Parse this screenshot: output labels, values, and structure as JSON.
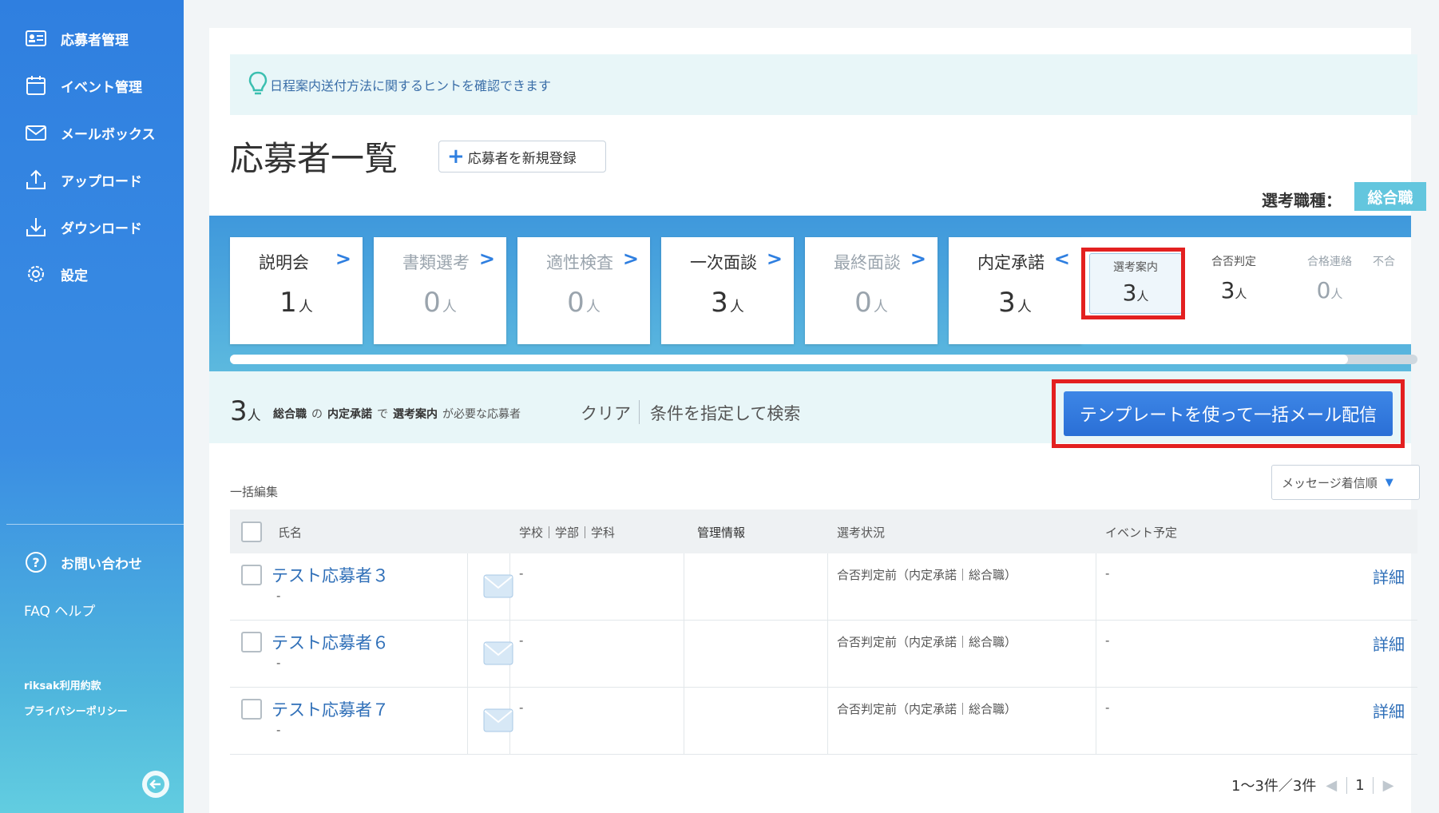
{
  "sidebar": {
    "items": [
      {
        "label": "応募者管理",
        "icon": "id-card-icon"
      },
      {
        "label": "イベント管理",
        "icon": "calendar-icon"
      },
      {
        "label": "メールボックス",
        "icon": "mail-icon"
      },
      {
        "label": "アップロード",
        "icon": "upload-icon"
      },
      {
        "label": "ダウンロード",
        "icon": "download-icon"
      },
      {
        "label": "設定",
        "icon": "gear-icon"
      }
    ],
    "contact": "お問い合わせ",
    "faq": "FAQ ヘルプ",
    "terms": "riksak利用約款",
    "privacy": "プライバシーポリシー"
  },
  "hint": {
    "text": "日程案内送付方法に関するヒントを確認できます"
  },
  "page_title": "応募者一覧",
  "register_button": "応募者を新規登録",
  "job": {
    "label": "選考職種：",
    "value": "総合職"
  },
  "stages": [
    {
      "name": "説明会",
      "count": "1",
      "unit": "人",
      "dim": false
    },
    {
      "name": "書類選考",
      "count": "0",
      "unit": "人",
      "dim": true
    },
    {
      "name": "適性検査",
      "count": "0",
      "unit": "人",
      "dim": true
    },
    {
      "name": "一次面談",
      "count": "3",
      "unit": "人",
      "dim": false
    },
    {
      "name": "最終面談",
      "count": "0",
      "unit": "人",
      "dim": true
    },
    {
      "name": "内定承諾",
      "count": "3",
      "unit": "人",
      "dim": false
    }
  ],
  "substages": [
    {
      "name": "選考案内",
      "count": "3",
      "unit": "人",
      "dim": false
    },
    {
      "name": "合否判定",
      "count": "3",
      "unit": "人",
      "dim": false
    },
    {
      "name": "合格連絡",
      "count": "0",
      "unit": "人",
      "dim": true
    },
    {
      "name": "不合",
      "count": "",
      "unit": "",
      "dim": true
    }
  ],
  "filter": {
    "count": "3",
    "unit": "人",
    "job": "総合職",
    "no": "の",
    "stage": "内定承諾",
    "de": "で",
    "substage": "選考案内",
    "suffix": "が必要な応募者",
    "clear": "クリア",
    "search": "条件を指定して検索",
    "template_button": "テンプレートを使って一括メール配信"
  },
  "bulk_edit": "一括編集",
  "sort": {
    "selected": "メッセージ着信順"
  },
  "table": {
    "headers": {
      "name": "氏名",
      "school": "学校｜学部｜学科",
      "mgmt": "管理情報",
      "status": "選考状況",
      "event": "イベント予定"
    },
    "rows": [
      {
        "name": "テスト応募者３",
        "sub": "-",
        "school": "-",
        "status": "合否判定前（内定承諾｜総合職）",
        "event": "-",
        "detail": "詳細"
      },
      {
        "name": "テスト応募者６",
        "sub": "-",
        "school": "-",
        "status": "合否判定前（内定承諾｜総合職）",
        "event": "-",
        "detail": "詳細"
      },
      {
        "name": "テスト応募者７",
        "sub": "-",
        "school": "-",
        "status": "合否判定前（内定承諾｜総合職）",
        "event": "-",
        "detail": "詳細"
      }
    ]
  },
  "pager": {
    "range": "1〜3件／3件",
    "page": "1"
  }
}
